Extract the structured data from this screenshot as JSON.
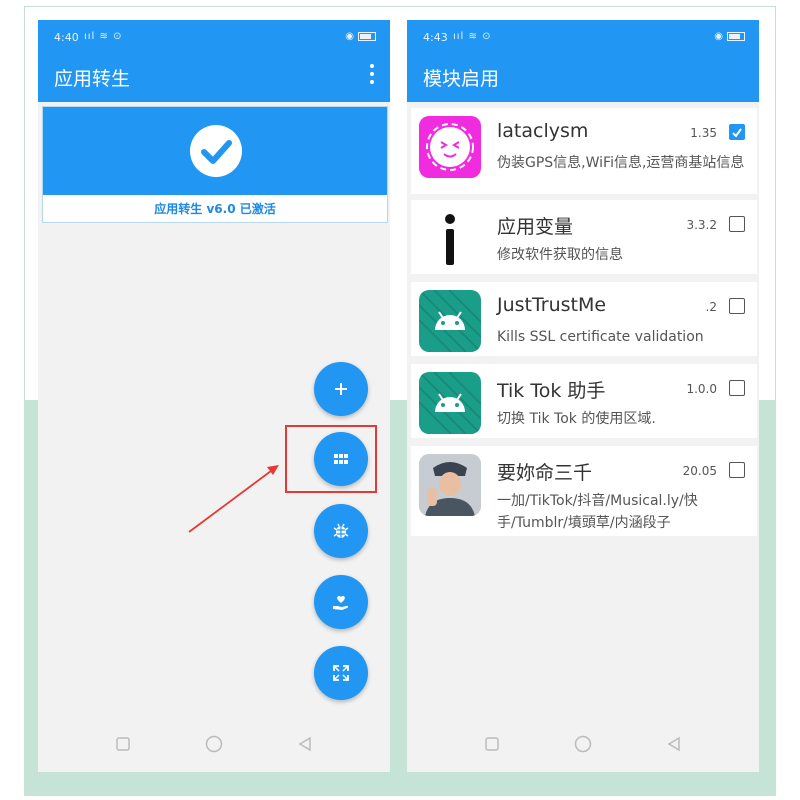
{
  "left_screen": {
    "status_time": "4:40",
    "app_title": "应用转生",
    "status_card_text": "应用转生 v6.0 已激活",
    "fab_icons": [
      "plus-icon",
      "grid-icon",
      "bug-icon",
      "hand-heart-icon",
      "expand-icon"
    ]
  },
  "right_screen": {
    "status_time": "4:43",
    "title": "模块启用",
    "modules": [
      {
        "name": "lataclysm",
        "version": "1.35",
        "description": "伪装GPS信息,WiFi信息,运营商基站信息",
        "checked": true
      },
      {
        "name": "应用变量",
        "version": "3.3.2",
        "description": "修改软件获取的信息",
        "checked": false
      },
      {
        "name": "JustTrustMe",
        "version": ".2",
        "description": "Kills SSL certificate validation",
        "checked": false
      },
      {
        "name": "Tik Tok 助手",
        "version": "1.0.0",
        "description": "切换 Tik Tok 的使用区域.",
        "checked": false
      },
      {
        "name": "要妳命三千",
        "version": "20.05",
        "description": "一加/TikTok/抖音/Musical.ly/快手/Tumblr/墳頭草/内涵段子",
        "checked": false
      }
    ]
  },
  "colors": {
    "primary": "#2196f3",
    "highlight": "#e53935",
    "band": "#c6e3d8",
    "android_teal": "#1a9e8a",
    "lataclysm_pink": "#f02be0"
  }
}
